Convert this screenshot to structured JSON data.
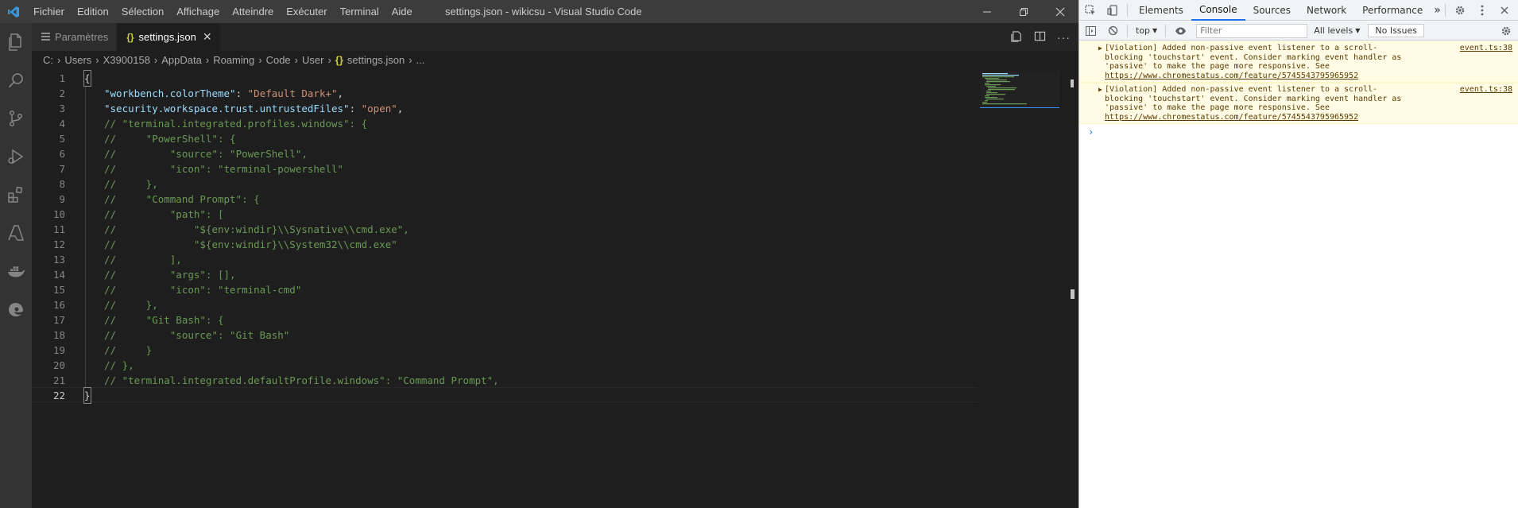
{
  "window": {
    "title": "settings.json - wikicsu - Visual Studio Code",
    "menu": [
      "Fichier",
      "Edition",
      "Sélection",
      "Affichage",
      "Atteindre",
      "Exécuter",
      "Terminal",
      "Aide"
    ]
  },
  "activity_bar": [
    "files-icon",
    "search-icon",
    "source-control-icon",
    "run-debug-icon",
    "extensions-icon",
    "azure-icon",
    "docker-icon",
    "edge-icon"
  ],
  "tabs": [
    {
      "label": "Paramètres",
      "icon": "settings-list-icon",
      "active": false
    },
    {
      "label": "settings.json",
      "icon": "{}",
      "active": true
    }
  ],
  "breadcrumb": [
    "C:",
    "Users",
    "X3900158",
    "AppData",
    "Roaming",
    "Code",
    "User",
    "settings.json",
    "..."
  ],
  "editor": {
    "line_numbers": [
      "1",
      "2",
      "3",
      "4",
      "5",
      "6",
      "7",
      "8",
      "9",
      "10",
      "11",
      "12",
      "13",
      "14",
      "15",
      "16",
      "17",
      "18",
      "19",
      "20",
      "21",
      "22"
    ],
    "lines": {
      "l1": "{",
      "l2_key": "\"workbench.colorTheme\"",
      "l2_colon": ": ",
      "l2_val": "\"Default Dark+\"",
      "l2_end": ",",
      "l3_key": "\"security.workspace.trust.untrustedFiles\"",
      "l3_colon": ": ",
      "l3_val": "\"open\"",
      "l3_end": ",",
      "l4": "// \"terminal.integrated.profiles.windows\": {",
      "l5": "//     \"PowerShell\": {",
      "l6": "//         \"source\": \"PowerShell\",",
      "l7": "//         \"icon\": \"terminal-powershell\"",
      "l8": "//     },",
      "l9": "//     \"Command Prompt\": {",
      "l10": "//         \"path\": [",
      "l11": "//             \"${env:windir}\\\\Sysnative\\\\cmd.exe\",",
      "l12": "//             \"${env:windir}\\\\System32\\\\cmd.exe\"",
      "l13": "//         ],",
      "l14": "//         \"args\": [],",
      "l15": "//         \"icon\": \"terminal-cmd\"",
      "l16": "//     },",
      "l17": "//     \"Git Bash\": {",
      "l18": "//         \"source\": \"Git Bash\"",
      "l19": "//     }",
      "l20": "// },",
      "l21": "// \"terminal.integrated.defaultProfile.windows\": \"Command Prompt\",",
      "l22": "}"
    }
  },
  "devtools": {
    "tabs": [
      "Elements",
      "Console",
      "Sources",
      "Network",
      "Performance"
    ],
    "active_tab": "Console",
    "more": "»",
    "context": "top",
    "filter_placeholder": "Filter",
    "levels": "All levels",
    "issues": "No Issues",
    "messages": [
      {
        "text": "[Violation] Added non-passive event listener to a scroll-blocking 'touchstart' event. Consider marking event handler as 'passive' to make the page more responsive. See ",
        "link": "https://www.chromestatus.com/feature/5745543795965952",
        "source": "event.ts:38"
      },
      {
        "text": "[Violation] Added non-passive event listener to a scroll-blocking 'touchstart' event. Consider marking event handler as 'passive' to make the page more responsive. See ",
        "link": "https://www.chromestatus.com/feature/5745543795965952",
        "source": "event.ts:38"
      }
    ],
    "prompt": "›"
  },
  "colors": {
    "titlebar": "#3c3c3c",
    "activitybar": "#333333",
    "editor_bg": "#1e1e1e",
    "json_key": "#9cdcfe",
    "json_string": "#ce9178",
    "comment": "#6a9955",
    "devtools_accent": "#1a73e8",
    "warning_bg": "#fffbe5"
  }
}
